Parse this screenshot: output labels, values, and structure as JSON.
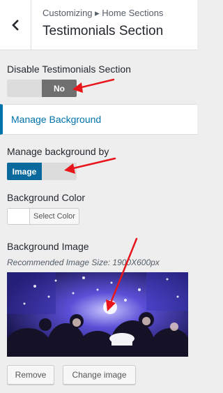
{
  "header": {
    "breadcrumb": "Customizing ▸ Home Sections",
    "title": "Testimonials Section",
    "back_icon": "chevron-left-icon"
  },
  "disable_section": {
    "label": "Disable Testimonials Section",
    "toggle_value": "No",
    "active_color": "#6f6f6f"
  },
  "manage_background_link": {
    "label": "Manage Background",
    "accent": "#0073aa"
  },
  "manage_background_by": {
    "label": "Manage background by",
    "toggle_value": "Image",
    "active_color": "#0a6a9e"
  },
  "background_color": {
    "label": "Background Color",
    "button_label": "Select Color"
  },
  "background_image": {
    "label": "Background Image",
    "hint": "Recommended Image Size: 1900X600px",
    "remove_label": "Remove",
    "change_label": "Change image"
  },
  "annotations": {
    "arrow_color": "#e8151b"
  }
}
